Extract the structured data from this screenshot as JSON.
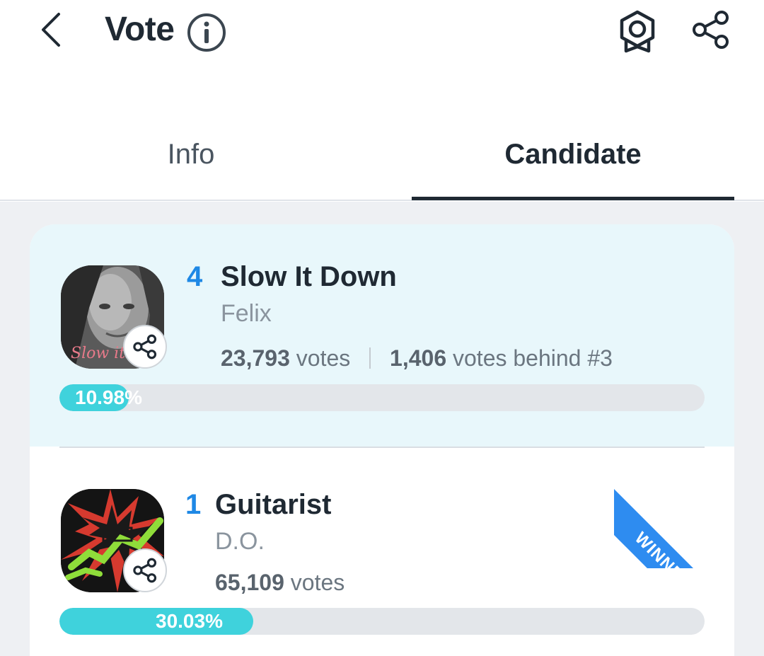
{
  "header": {
    "title": "Vote"
  },
  "tabs": [
    {
      "label": "Info",
      "active": false
    },
    {
      "label": "Candidate",
      "active": true
    }
  ],
  "candidates": [
    {
      "rank": "4",
      "song": "Slow It Down",
      "artist": "Felix",
      "votes_count": "23,793",
      "votes_word": "votes",
      "behind_count": "1,406",
      "behind_text": "votes behind #3",
      "percent_label": "10.98%",
      "percent_value": 10.98,
      "highlighted": true,
      "album_text": "Slow it"
    },
    {
      "rank": "1",
      "song": "Guitarist",
      "artist": "D.O.",
      "votes_count": "65,109",
      "votes_word": "votes",
      "percent_label": "30.03%",
      "percent_value": 30.03,
      "badge": "WINNER"
    }
  ],
  "colors": {
    "accent": "#1e88e5",
    "bar_fill": "#3fd2dc",
    "ribbon": "#2e8cf0",
    "highlight_row": "#e8f7fb"
  },
  "icons": {
    "back": "chevron-left-icon",
    "info": "info-circle-icon",
    "badge": "award-badge-icon",
    "share": "share-icon"
  }
}
